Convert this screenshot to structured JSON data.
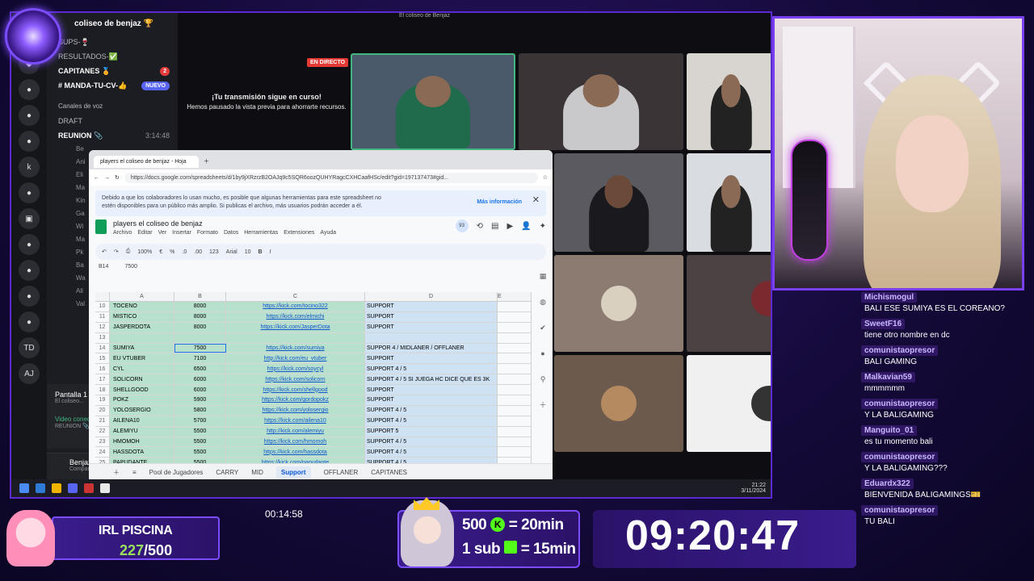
{
  "window_title": "El coliseo de Benjaz",
  "discord": {
    "guild": "coliseo de benjaz 🏆",
    "channels": [
      {
        "label": "SUPS-🍷",
        "badge": ""
      },
      {
        "label": "RESULTADOS-✅",
        "badge": ""
      },
      {
        "label": "CAPITANES 🏅",
        "badge": "2",
        "red": true
      },
      {
        "label": "# MANDA-TU-CV-👍",
        "badge": "NUEVO"
      }
    ],
    "voice_category": "Canales de voz",
    "voice_channels": [
      {
        "label": "DRAFT",
        "time": ""
      },
      {
        "label": "REUNION 📎",
        "time": "3:14:48"
      }
    ],
    "voice_users": [
      "Be",
      "Ani",
      "Eli",
      "Ma",
      "Kin",
      "Ga",
      "Wi",
      "Ma",
      "Pk",
      "Ba",
      "Wa",
      "Ali",
      "Val"
    ],
    "status_title": "Pantalla 1",
    "status_sub": "El coliseo...",
    "video_label": "Video conectado",
    "video_sub": "REUNION 📎 / El co...",
    "user_name": "Benjaz",
    "user_status": "Compartiendo su..."
  },
  "stream_preview": {
    "live": "EN DIRECTO",
    "headline": "¡Tu transmisión sigue en curso!",
    "body": "Hemos pausado la vista previa para ahorrarte recursos."
  },
  "browser": {
    "tab": "players el coliseo de benjaz - Hoja",
    "url": "https://docs.google.com/spreadsheets/d/1by9jXRzrzB2OAJq9c5SQR6oozQUHYRagcCXHCaafHSc/edit?gid=197137473#gid...",
    "notice": "Debido a que los colaboradores lo usan mucho, es posible que algunas herramientas para este spreadsheet no estén disponibles para un público más amplio. Si publicas el archivo, más usuarios podrán acceder a él.",
    "notice_link": "Más información"
  },
  "sheet": {
    "title": "players el coliseo de benjaz",
    "menu": [
      "Archivo",
      "Editar",
      "Ver",
      "Insertar",
      "Formato",
      "Datos",
      "Herramientas",
      "Extensiones",
      "Ayuda"
    ],
    "toolbar": {
      "zoom": "100%",
      "currency": "€",
      "percent": "%",
      "decimals": ".0",
      "decimals2": ".00",
      "number_fmt": "123",
      "font": "Arial",
      "font_size": "10",
      "bold": "B",
      "italic": "I"
    },
    "cell_ref": "B14",
    "cell_value": "7500",
    "avatar_count": "93",
    "columns": [
      "",
      "A",
      "B",
      "C",
      "D",
      "E"
    ],
    "rows": [
      {
        "n": "10",
        "a": "TOCENO",
        "b": "8000",
        "c": "https://kick.com/tocino322",
        "d": "SUPPORT"
      },
      {
        "n": "11",
        "a": "MISTICO",
        "b": "8000",
        "c": "https://kick.com/elmichi",
        "d": "SUPPORT"
      },
      {
        "n": "12",
        "a": "JASPERDOTA",
        "b": "8000",
        "c": "https://kick.com/JasperDota",
        "d": "SUPPORT"
      },
      {
        "n": "13",
        "a": "",
        "b": "",
        "c": "",
        "d": ""
      },
      {
        "n": "14",
        "a": "SUMIYA",
        "b": "7500",
        "c": "https://kick.com/sumiya",
        "d": "SUPPOR 4 / MIDLANER / OFFLANER",
        "sel": true
      },
      {
        "n": "15",
        "a": "EU VTUBER",
        "b": "7100",
        "c": "http://kick.com/eu_vtuber",
        "d": "SUPPORT"
      },
      {
        "n": "16",
        "a": "CYL",
        "b": "6500",
        "c": "https://kick.com/soycyl",
        "d": "SUPPORT 4 / 5"
      },
      {
        "n": "17",
        "a": "SOLICORN",
        "b": "6000",
        "c": "https://kick.com/solicorn",
        "d": "SUPPORT 4 / 5 SI JUEGA HC DICE QUE ES 3K"
      },
      {
        "n": "18",
        "a": "SHELLGOOD",
        "b": "6000",
        "c": "https://kick.com/shellgood",
        "d": "SUPPORT"
      },
      {
        "n": "19",
        "a": "POKZ",
        "b": "5900",
        "c": "https://kick.com/gordopokz",
        "d": "SUPPORT"
      },
      {
        "n": "20",
        "a": "YOLOSERGIO",
        "b": "5800",
        "c": "https://kick.com/yolosergio",
        "d": "SUPPORT 4 / 5"
      },
      {
        "n": "21",
        "a": "AILENA10",
        "b": "5700",
        "c": "https://kick.com/ailena10",
        "d": "SUPPORT 4 / 5"
      },
      {
        "n": "22",
        "a": "ALEMIYU",
        "b": "5500",
        "c": "http://kick.com/alemiyu",
        "d": "SUPPORT 5"
      },
      {
        "n": "23",
        "a": "HMOMOH",
        "b": "5500",
        "c": "https://kick.com/hmomoh",
        "d": "SUPPORT 4 / 5"
      },
      {
        "n": "24",
        "a": "HASSDOTA",
        "b": "5500",
        "c": "https://kick.com/hassdota",
        "d": "SUPPORT 4 / 5"
      },
      {
        "n": "25",
        "a": "PAPUDANTE",
        "b": "5500",
        "c": "https://kick.com/papudante",
        "d": "SUPPORT 4 / 5"
      }
    ],
    "tabs": [
      "Pool de Jugadores",
      "CARRY",
      "MID",
      "Support",
      "OFFLANER",
      "CAPITANES"
    ],
    "active_tab": "Support"
  },
  "taskbar": {
    "time": "21:22",
    "date": "3/11/2024"
  },
  "chat": [
    {
      "user": "Michismogul",
      "msg": "BALI ESE SUMIYA ES EL COREANO?"
    },
    {
      "user": "SweetF16",
      "msg": "tiene otro nombre en dc"
    },
    {
      "user": "comunistaopresor",
      "msg": "BALI GAMING"
    },
    {
      "user": "Malkavian59",
      "msg": "mmmmmm"
    },
    {
      "user": "comunistaopresor",
      "msg": "Y LA BALIGAMING"
    },
    {
      "user": "Manguito_01",
      "msg": "es tu momento bali"
    },
    {
      "user": "comunistaopresor",
      "msg": "Y LA BALIGAMING???"
    },
    {
      "user": "Eduardx322",
      "msg": "BIENVENIDA BALIGAMINGS🎫"
    },
    {
      "user": "comunistaopresor",
      "msg": "TU BALI"
    }
  ],
  "overlay": {
    "goal_title": "IRL PISCINA",
    "goal_current": "227",
    "goal_total": "/500",
    "elapsed": "00:14:58",
    "rate1_a": "500",
    "rate1_b": "= 20min",
    "rate2_a": "1 sub",
    "rate2_b": "= 15min",
    "clock": "09:20:47"
  },
  "colors": {
    "accent": "#7c4dff",
    "kick_green": "#53fc18",
    "live_red": "#e53935"
  }
}
